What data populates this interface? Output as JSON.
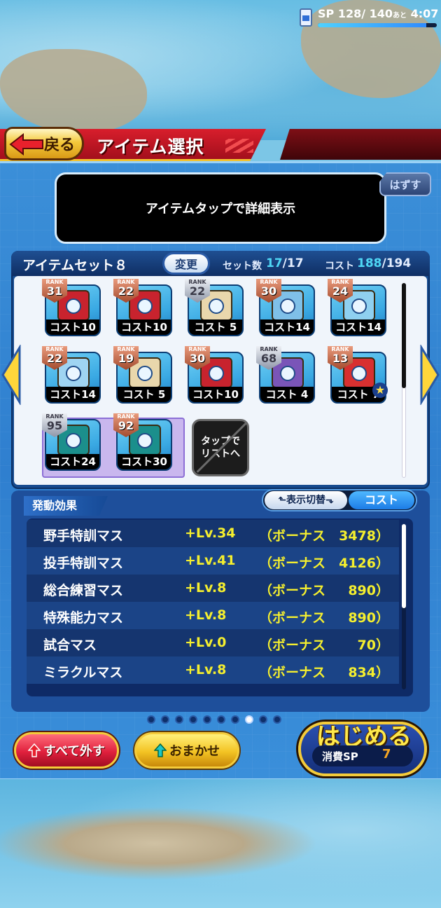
{
  "header": {
    "back_label": "戻る",
    "title": "アイテム選択",
    "sp_label": "SP",
    "sp_current": "128",
    "sp_max": "140",
    "sp_remaining_word": "あと",
    "sp_time": "4:07",
    "sp_fraction": 0.914
  },
  "info_box": {
    "text": "アイテムタップで詳細表示",
    "remove_label": "はずす"
  },
  "item_set": {
    "name": "アイテムセット８",
    "change_label": "変更",
    "count_label": "セット数",
    "count_current": "17",
    "count_max": "17",
    "cost_label": "コスト",
    "cost_current": "188",
    "cost_max": "194",
    "items": [
      {
        "rank_word": "RANK",
        "rank": "31",
        "rank_tier": "copper",
        "cost": "コスト10",
        "icon": "red-book-pencil-icon"
      },
      {
        "rank_word": "RANK",
        "rank": "22",
        "rank_tier": "copper",
        "cost": "コスト10",
        "icon": "red-book-baseball-icon"
      },
      {
        "rank_word": "RANK",
        "rank": "22",
        "rank_tier": "silver",
        "cost": "コスト 5",
        "icon": "scroll-bat-icon"
      },
      {
        "rank_word": "RANK",
        "rank": "30",
        "rank_tier": "copper",
        "cost": "コスト14",
        "icon": "scroll-glove-icon"
      },
      {
        "rank_word": "RANK",
        "rank": "24",
        "rank_tier": "copper",
        "cost": "コスト14",
        "icon": "scroll-target-icon"
      },
      {
        "rank_word": "RANK",
        "rank": "22",
        "rank_tier": "copper",
        "cost": "コスト14",
        "icon": "scroll-whistle-icon"
      },
      {
        "rank_word": "RANK",
        "rank": "19",
        "rank_tier": "copper",
        "cost": "コスト 5",
        "icon": "scroll-dumbbell-icon"
      },
      {
        "rank_word": "RANK",
        "rank": "30",
        "rank_tier": "copper",
        "cost": "コスト10",
        "icon": "red-book-baseball-icon"
      },
      {
        "rank_word": "RANK",
        "rank": "68",
        "rank_tier": "silver",
        "cost": "コスト 4",
        "icon": "purple-bag-icon"
      },
      {
        "rank_word": "RANK",
        "rank": "13",
        "rank_tier": "copper",
        "cost": "コスト 7",
        "icon": "energy-drink-icon"
      },
      {
        "rank_word": "RANK",
        "rank": "95",
        "rank_tier": "silver",
        "cost": "コスト24",
        "icon": "teal-book-baseball-icon"
      },
      {
        "rank_word": "RANK",
        "rank": "92",
        "rank_tier": "copper",
        "cost": "コスト30",
        "icon": "teal-book-pencil-icon"
      }
    ],
    "tap_list_label_1": "タップで",
    "tap_list_label_2": "リストへ"
  },
  "effects": {
    "section_label": "発動効果",
    "toggle_left": "表示切替",
    "toggle_right": "コスト",
    "rows": [
      {
        "name": "野手特訓マス",
        "level": "+Lv.34",
        "bonus_label": "（ボーナス",
        "value": "3478）"
      },
      {
        "name": "投手特訓マス",
        "level": "+Lv.41",
        "bonus_label": "（ボーナス",
        "value": "4126）"
      },
      {
        "name": "総合練習マス",
        "level": "+Lv.8",
        "bonus_label": "（ボーナス",
        "value": "890）"
      },
      {
        "name": "特殊能力マス",
        "level": "+Lv.8",
        "bonus_label": "（ボーナス",
        "value": "890）"
      },
      {
        "name": "試合マス",
        "level": "+Lv.0",
        "bonus_label": "（ボーナス",
        "value": "70）"
      },
      {
        "name": "ミラクルマス",
        "level": "+Lv.8",
        "bonus_label": "（ボーナス",
        "value": "834）"
      }
    ]
  },
  "pagination": {
    "total": 10,
    "active_index": 7
  },
  "buttons": {
    "remove_all": "すべて外す",
    "auto": "おまかせ",
    "start": "はじめる",
    "start_sp_label": "消費SP",
    "start_sp_value": "7"
  },
  "colors": {
    "accent_yellow": "#f5ef2e",
    "header_red": "#c4162a",
    "panel_blue": "#1e4f9b",
    "count_cyan": "#4fd7f5"
  }
}
